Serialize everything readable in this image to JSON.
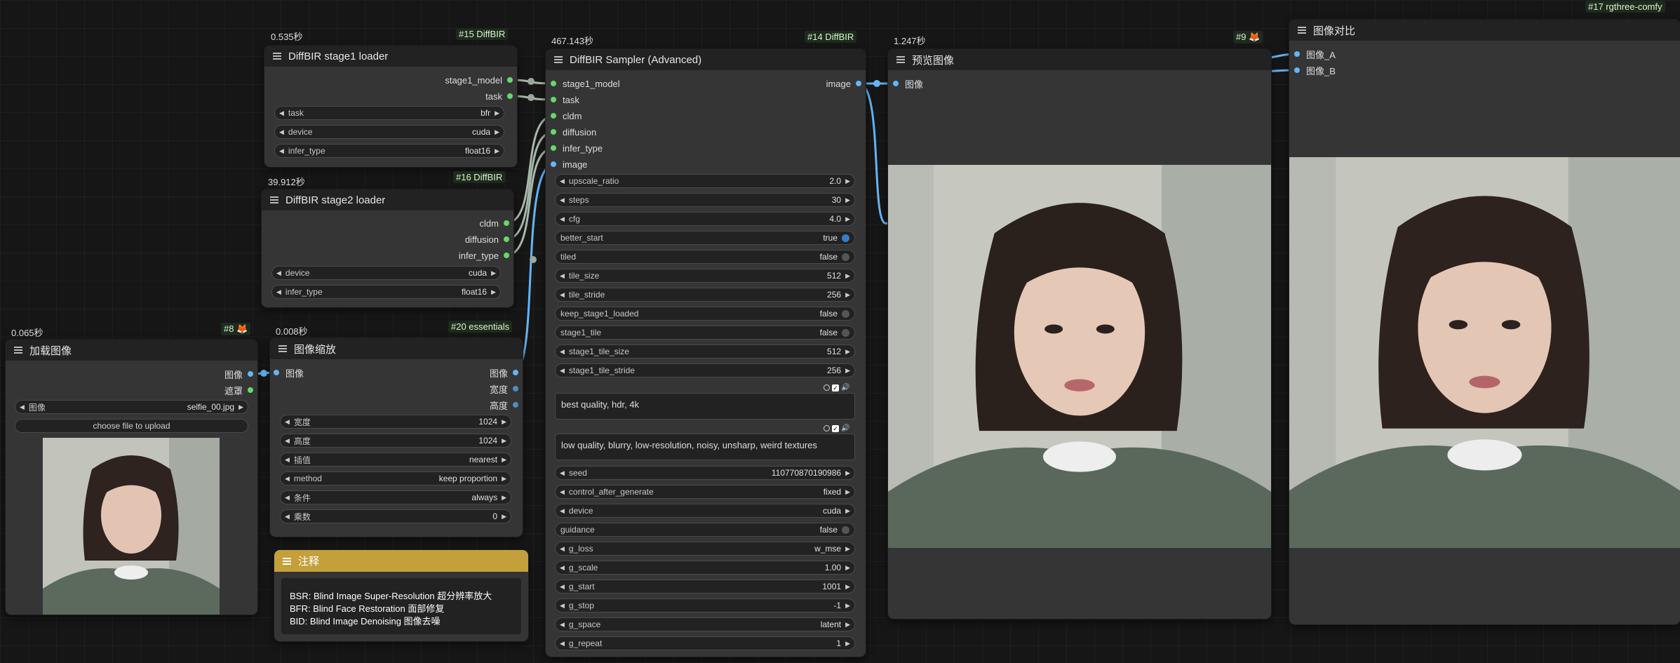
{
  "colors": {
    "canvas_bg": "#161616",
    "node_bg": "#353535",
    "header_bg": "#222222",
    "note_header": "#c3a03a",
    "image_link": "#64b5f6",
    "model_link": "#a7b8a9"
  },
  "top_right_badge": "#17 rgthree-comfy",
  "nodes": {
    "stage1_loader": {
      "time": "0.535秒",
      "badge": "#15 DiffBIR",
      "title": "DiffBIR stage1 loader",
      "outputs": [
        "stage1_model",
        "task"
      ],
      "widgets": [
        {
          "label": "task",
          "value": "bfr"
        },
        {
          "label": "device",
          "value": "cuda"
        },
        {
          "label": "infer_type",
          "value": "float16"
        }
      ]
    },
    "stage2_loader": {
      "time": "39.912秒",
      "badge": "#16 DiffBIR",
      "title": "DiffBIR stage2 loader",
      "outputs": [
        "cldm",
        "diffusion",
        "infer_type"
      ],
      "widgets": [
        {
          "label": "device",
          "value": "cuda"
        },
        {
          "label": "infer_type",
          "value": "float16"
        }
      ]
    },
    "load_image": {
      "time": "0.065秒",
      "badge": "#8 🦊",
      "title": "加载图像",
      "outputs": [
        "图像",
        "遮罩"
      ],
      "widget": {
        "label": "图像",
        "value": "selfie_00.jpg"
      },
      "upload_button": "choose file to upload"
    },
    "image_scale": {
      "time": "0.008秒",
      "badge": "#20 essentials",
      "title": "图像缩放",
      "inputs": [
        "图像"
      ],
      "outputs": [
        "图像",
        "宽度",
        "高度"
      ],
      "widgets": [
        {
          "label": "宽度",
          "value": "1024"
        },
        {
          "label": "高度",
          "value": "1024"
        },
        {
          "label": "插值",
          "value": "nearest"
        },
        {
          "label": "method",
          "value": "keep proportion"
        },
        {
          "label": "条件",
          "value": "always"
        },
        {
          "label": "乘数",
          "value": "0"
        }
      ]
    },
    "note": {
      "title": "注释",
      "lines": [
        "BSR: Blind Image Super-Resolution 超分辨率放大",
        "BFR: Blind Face Restoration 面部修复",
        "BID: Blind Image Denoising 图像去噪"
      ]
    },
    "sampler": {
      "time": "467.143秒",
      "badge": "#14 DiffBIR",
      "title": "DiffBIR Sampler (Advanced)",
      "inputs": [
        "stage1_model",
        "task",
        "cldm",
        "diffusion",
        "infer_type",
        "image"
      ],
      "output": "image",
      "widgets_a": [
        {
          "label": "upscale_ratio",
          "value": "2.0"
        },
        {
          "label": "steps",
          "value": "30"
        },
        {
          "label": "cfg",
          "value": "4.0"
        }
      ],
      "toggles_a": [
        {
          "label": "better_start",
          "value": "true",
          "on": true
        },
        {
          "label": "tiled",
          "value": "false",
          "on": false
        }
      ],
      "widgets_b": [
        {
          "label": "tile_size",
          "value": "512"
        },
        {
          "label": "tile_stride",
          "value": "256"
        }
      ],
      "toggles_b": [
        {
          "label": "keep_stage1_loaded",
          "value": "false",
          "on": false
        },
        {
          "label": "stage1_tile",
          "value": "false",
          "on": false
        }
      ],
      "widgets_c": [
        {
          "label": "stage1_tile_size",
          "value": "512"
        },
        {
          "label": "stage1_tile_stride",
          "value": "256"
        }
      ],
      "positive_prompt": "best quality, hdr, 4k",
      "negative_prompt": "low quality, blurry, low-resolution, noisy, unsharp, weird textures",
      "widgets_d": [
        {
          "label": "seed",
          "value": "110770870190986"
        },
        {
          "label": "control_after_generate",
          "value": "fixed"
        },
        {
          "label": "device",
          "value": "cuda"
        }
      ],
      "toggle_guidance": {
        "label": "guidance",
        "value": "false",
        "on": false
      },
      "widgets_e": [
        {
          "label": "g_loss",
          "value": "w_mse"
        },
        {
          "label": "g_scale",
          "value": "1.00"
        },
        {
          "label": "g_start",
          "value": "1001"
        },
        {
          "label": "g_stop",
          "value": "-1"
        },
        {
          "label": "g_space",
          "value": "latent"
        },
        {
          "label": "g_repeat",
          "value": "1"
        }
      ]
    },
    "preview": {
      "time": "1.247秒",
      "badge": "#9 🦊",
      "title": "预览图像",
      "inputs": [
        "图像"
      ]
    },
    "compare": {
      "title": "图像对比",
      "inputs": [
        "图像_A",
        "图像_B"
      ]
    }
  }
}
